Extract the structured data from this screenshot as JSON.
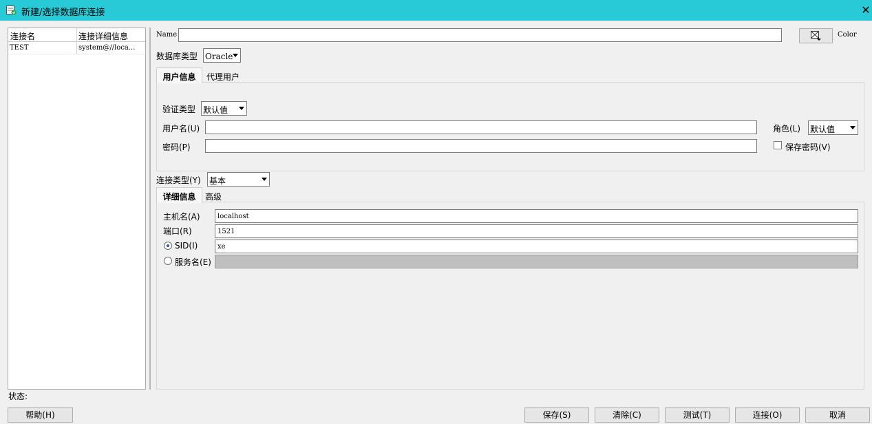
{
  "window": {
    "title": "新建/选择数据库连接",
    "close_glyph": "✕"
  },
  "connections": {
    "columns": [
      "连接名",
      "连接详细信息"
    ],
    "rows": [
      {
        "name": "TEST",
        "details": "system@//loca..."
      }
    ]
  },
  "form": {
    "name_label": "Name",
    "name_value": "",
    "color_label": "Color",
    "db_type_label": "数据库类型",
    "db_type_value": "Oracle",
    "user_tabs": [
      "用户信息",
      "代理用户"
    ],
    "auth_type_label": "验证类型",
    "auth_type_value": "默认值",
    "username_label": "用户名(U)",
    "username_value": "",
    "password_label": "密码(P)",
    "password_value": "",
    "role_label": "角色(L)",
    "role_value": "默认值",
    "save_password_label": "保存密码(V)",
    "save_password_checked": false,
    "conn_type_label": "连接类型(Y)",
    "conn_type_value": "基本",
    "detail_tabs": [
      "详细信息",
      "高级"
    ],
    "hostname_label": "主机名(A)",
    "hostname_value": "localhost",
    "port_label": "端口(R)",
    "port_value": "1521",
    "sid_label": "SID(I)",
    "sid_value": "xe",
    "sid_selected": true,
    "service_name_label": "服务名(E)",
    "service_name_value": ""
  },
  "status": {
    "label": "状态:"
  },
  "buttons": {
    "help": "帮助(H)",
    "save": "保存(S)",
    "clear": "清除(C)",
    "test": "测试(T)",
    "connect": "连接(O)",
    "cancel": "取消"
  },
  "colors": {
    "titlebar": "#27cad6",
    "window_bg": "#f0f0f0"
  }
}
